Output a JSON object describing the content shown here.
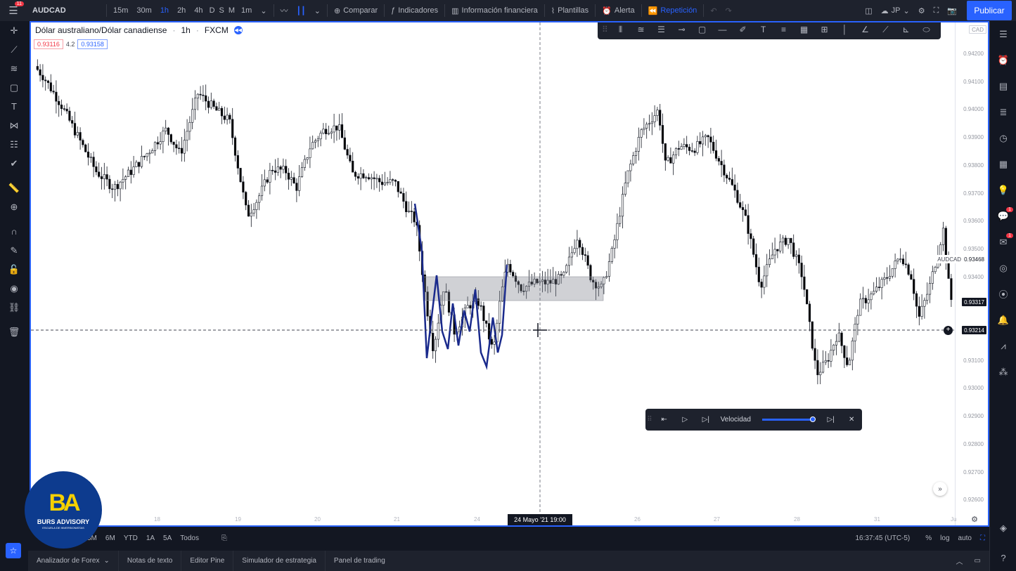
{
  "topbar": {
    "symbol": "AUDCAD",
    "intervals": [
      "15m",
      "30m",
      "1h",
      "2h",
      "4h",
      "D",
      "S",
      "M",
      "1m"
    ],
    "active_interval": "1h",
    "compare": "Comparar",
    "indicators": "Indicadores",
    "financial_info": "Información financiera",
    "templates": "Plantillas",
    "alert": "Alerta",
    "replay": "Repetición",
    "layout_label": "JP",
    "publish": "Publicar",
    "notification_count": "11"
  },
  "legend": {
    "title": "Dólar australiano/Dólar canadiense",
    "interval": "1h",
    "exchange": "FXCM",
    "sell_price": "0.93116",
    "spread": "4.2",
    "buy_price": "0.93158"
  },
  "price_axis": {
    "currency": "CAD",
    "labels": [
      "0.94200",
      "0.94100",
      "0.94000",
      "0.93900",
      "0.93800",
      "0.93700",
      "0.93600",
      "0.93500",
      "0.93400",
      "0.93300",
      "0.93100",
      "0.93000",
      "0.92900",
      "0.92800",
      "0.92700",
      "0.92600"
    ],
    "symbol_tag": "AUDCAD",
    "symbol_price": "0.93468",
    "last_price": "0.93317",
    "crosshair_price": "0.93214"
  },
  "time_axis": {
    "labels": [
      "18",
      "19",
      "20",
      "21",
      "24",
      "26",
      "27",
      "28",
      "31",
      "Ju"
    ],
    "crosshair_date": "24 Mayo '21   19:00"
  },
  "replay_bar": {
    "speed_label": "Velocidad",
    "speed_value": 1.0
  },
  "bottombar": {
    "ranges": [
      "3M",
      "6M",
      "YTD",
      "1A",
      "5A",
      "Todos"
    ],
    "clock": "16:37:45 (UTC-5)",
    "percent": "%",
    "log": "log",
    "auto": "auto"
  },
  "panels": [
    "Analizador de Forex",
    "Notas de texto",
    "Editor Pine",
    "Simulador de estrategia",
    "Panel de trading"
  ],
  "logo": {
    "mark": "BA",
    "name": "BURS ADVISORY",
    "tagline": "ESCUELA DE INVERSIONISTAS"
  },
  "right_badges": [
    "1",
    "1"
  ],
  "colors": {
    "accent": "#2962ff",
    "bull": "#ffffff",
    "bear": "#000000",
    "drawing": "#1a2a8c"
  }
}
